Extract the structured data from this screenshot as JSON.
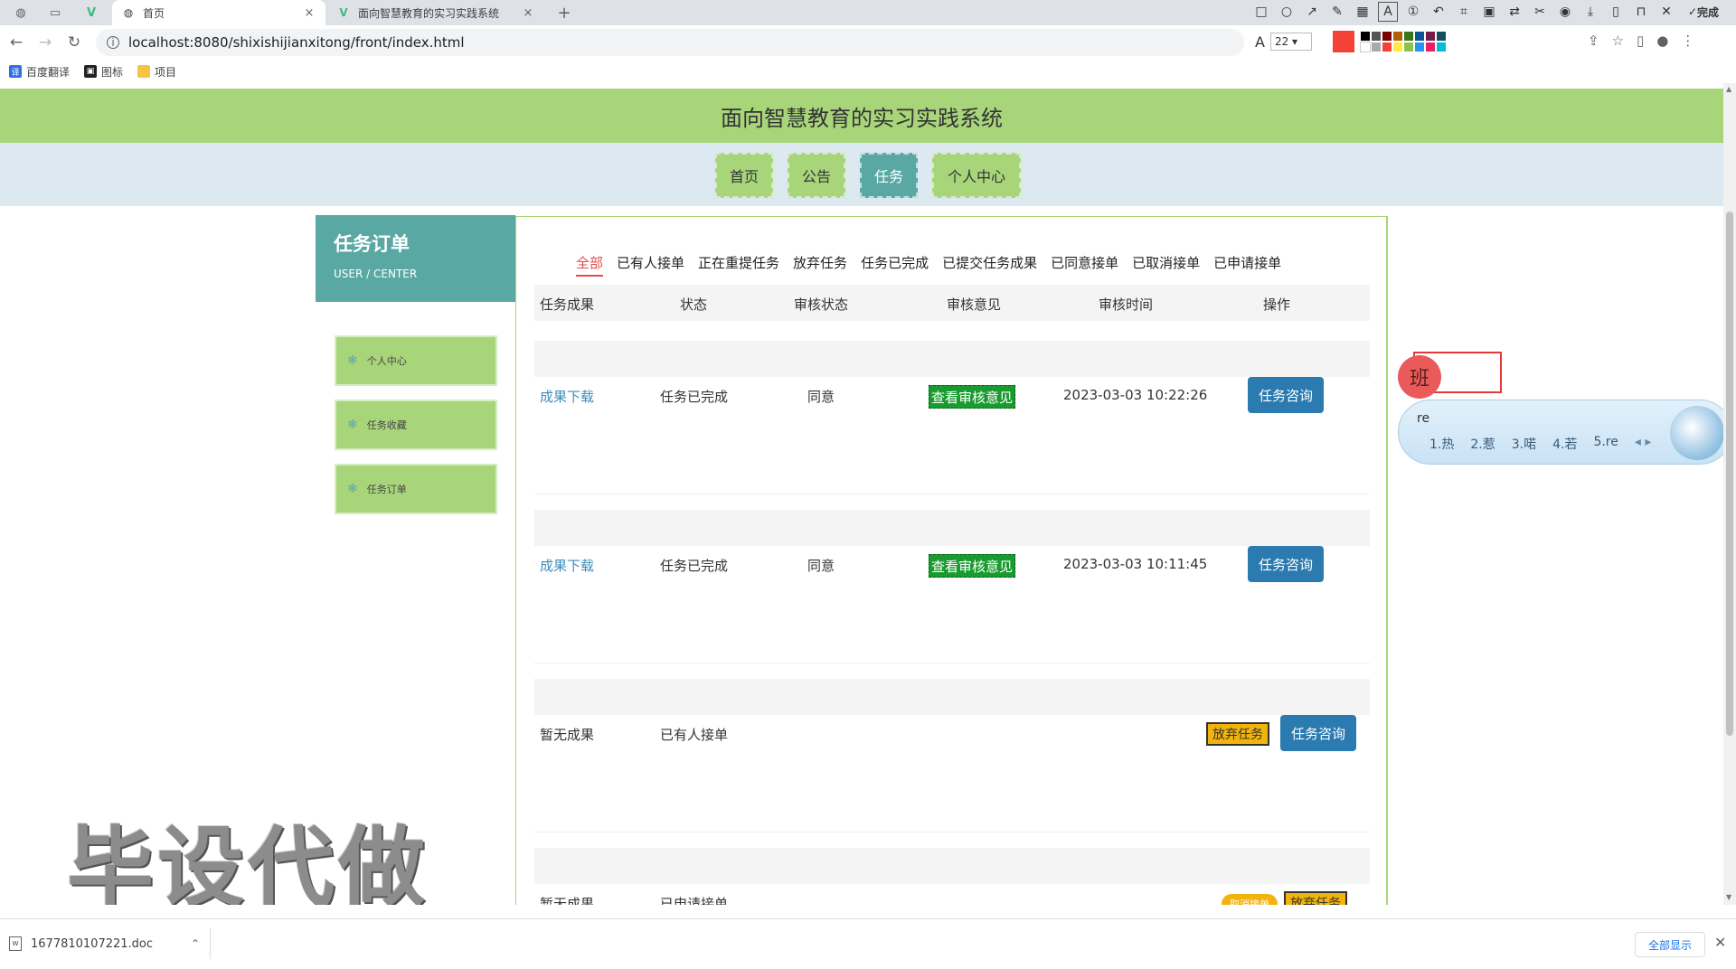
{
  "browser": {
    "tabs": [
      {
        "title": "首页",
        "close": "×"
      },
      {
        "title": "面向智慧教育的实习实践系统",
        "close": "×"
      }
    ],
    "new_tab": "+",
    "url": "localhost:8080/shixishijianxitong/front/index.html",
    "bookmarks": [
      "百度翻译",
      "图标",
      "项目"
    ],
    "screenshot_tool": {
      "font_size": "22",
      "done_label": "完成",
      "accent_color": "#f44336"
    }
  },
  "site": {
    "title": "面向智慧教育的实习实践系统",
    "nav": [
      "首页",
      "公告",
      "任务",
      "个人中心"
    ],
    "active_nav": "任务"
  },
  "sidebar": {
    "title": "任务订单",
    "subtitle": "USER / CENTER",
    "items": [
      "个人中心",
      "任务收藏",
      "任务订单"
    ]
  },
  "filters": {
    "tabs": [
      "全部",
      "已有人接单",
      "正在重提任务",
      "放弃任务",
      "任务已完成",
      "已提交任务成果",
      "已同意接单",
      "已取消接单",
      "已申请接单"
    ],
    "active": "全部"
  },
  "table": {
    "columns": [
      "任务成果",
      "状态",
      "审核状态",
      "审核意见",
      "审核时间",
      "操作"
    ],
    "rows": [
      {
        "result": "成果下载",
        "status": "任务已完成",
        "review_status": "同意",
        "review_btn": "查看审核意见",
        "review_time": "2023-03-03 10:22:26",
        "actions": [
          "任务咨询"
        ]
      },
      {
        "result": "成果下载",
        "status": "任务已完成",
        "review_status": "同意",
        "review_btn": "查看审核意见",
        "review_time": "2023-03-03 10:11:45",
        "actions": [
          "任务咨询"
        ]
      },
      {
        "result": "暂无成果",
        "status": "已有人接单",
        "review_status": "",
        "review_btn": "",
        "review_time": "",
        "actions": [
          "放弃任务",
          "任务咨询"
        ]
      },
      {
        "result": "暂无成果",
        "status": "已申请接单",
        "review_status": "",
        "review_btn": "",
        "review_time": "",
        "actions": [
          "取消接单",
          "放弃任务"
        ]
      }
    ]
  },
  "ime": {
    "char": "班",
    "pinyin": "re",
    "candidates": [
      "1.热",
      "2.惹",
      "3.喏",
      "4.若",
      "5.re"
    ]
  },
  "watermark": "毕设代做",
  "downloads": {
    "file": "1677810107221.doc",
    "show_all": "全部显示"
  },
  "colors": {
    "header_green": "#a8d57a",
    "teal": "#5aa8a4",
    "nav_bg": "#dde9f0",
    "button_blue": "#2b7bb1",
    "badge_green": "#1a9b30",
    "orange": "#f2b30c",
    "active_tab_red": "#e34b4b"
  }
}
